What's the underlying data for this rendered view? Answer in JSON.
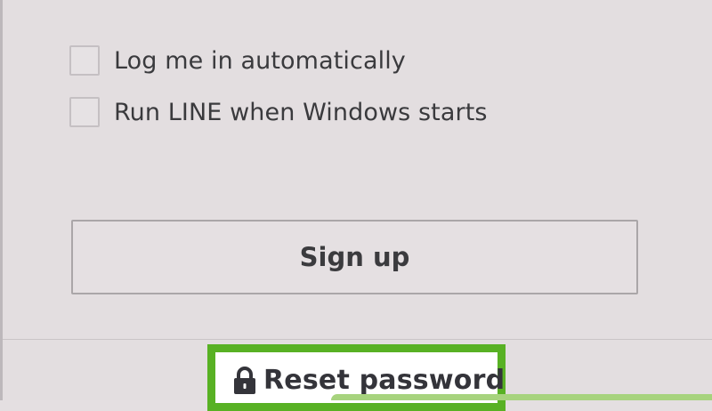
{
  "options": {
    "auto_login_label": "Log me in automatically",
    "run_on_startup_label": "Run LINE when Windows starts",
    "auto_login_checked": false,
    "run_on_startup_checked": false
  },
  "actions": {
    "signup_label": "Sign up",
    "reset_password_label": "Reset password"
  },
  "icons": {
    "reset": "lock-icon"
  },
  "colors": {
    "background": "#e3dee0",
    "highlight": "#58b124",
    "text": "#3a3a3d",
    "accent_bar": "#a7d37e"
  }
}
